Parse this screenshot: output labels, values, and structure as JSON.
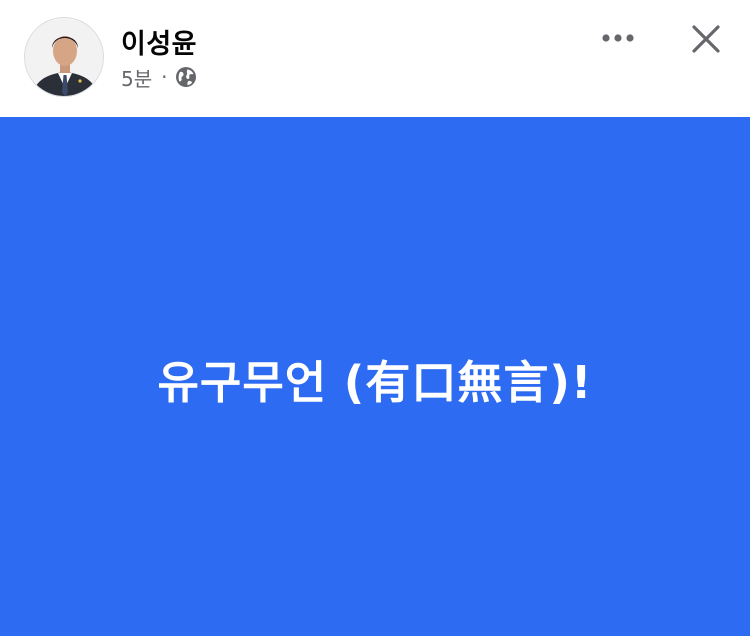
{
  "header": {
    "author_name": "이성윤",
    "timestamp": "5분",
    "separator": "·",
    "audience_icon": "globe-icon",
    "more_icon": "more-horizontal-icon",
    "close_icon": "close-icon"
  },
  "post": {
    "text": "유구무언 (有口無言)!",
    "background_color": "#2d6bf2",
    "text_color": "#ffffff"
  },
  "colors": {
    "secondary_text": "#65676b",
    "primary_text": "#050505"
  }
}
